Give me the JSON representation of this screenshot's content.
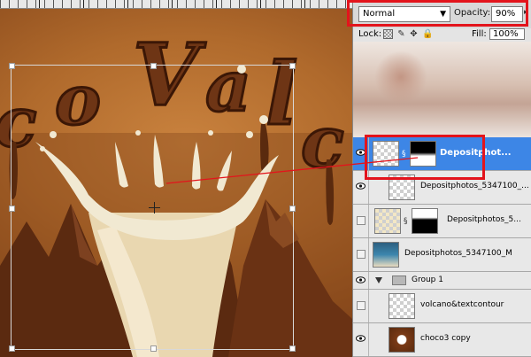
{
  "canvas": {
    "letters": [
      "c",
      "o",
      "V",
      "a",
      "l",
      "c"
    ],
    "colors": {
      "chocolate": "#6e3515",
      "milk": "#f1e9d2",
      "background": "#b06a2c"
    }
  },
  "panel": {
    "blend_mode": "Normal",
    "opacity_label": "Opacity:",
    "opacity_value": "90%",
    "lock_label": "Lock:",
    "lock_icons": [
      "checkerboard-icon",
      "brush-icon",
      "move-icon",
      "lock-icon"
    ],
    "fill_label": "Fill:",
    "fill_value": "100%"
  },
  "layers": [
    {
      "name": "Depositphot...",
      "visible": true,
      "selected": true,
      "has_mask": true
    },
    {
      "name": "Depositphotos_5347100_...",
      "visible": true,
      "selected": false,
      "has_mask": false
    },
    {
      "name": "Depositphotos_5...",
      "visible": false,
      "selected": false,
      "has_mask": true
    },
    {
      "name": "Depositphotos_5347100_M",
      "visible": false,
      "selected": false,
      "has_mask": false
    },
    {
      "name": "Group 1",
      "visible": true,
      "selected": false,
      "is_group": true
    },
    {
      "name": "volcano&textcontour",
      "visible": false,
      "selected": false,
      "has_mask": false
    },
    {
      "name": "choco3 copy",
      "visible": true,
      "selected": false,
      "has_mask": false
    }
  ],
  "highlight_color": "#e3141c",
  "selection_color": "#3d86e6"
}
